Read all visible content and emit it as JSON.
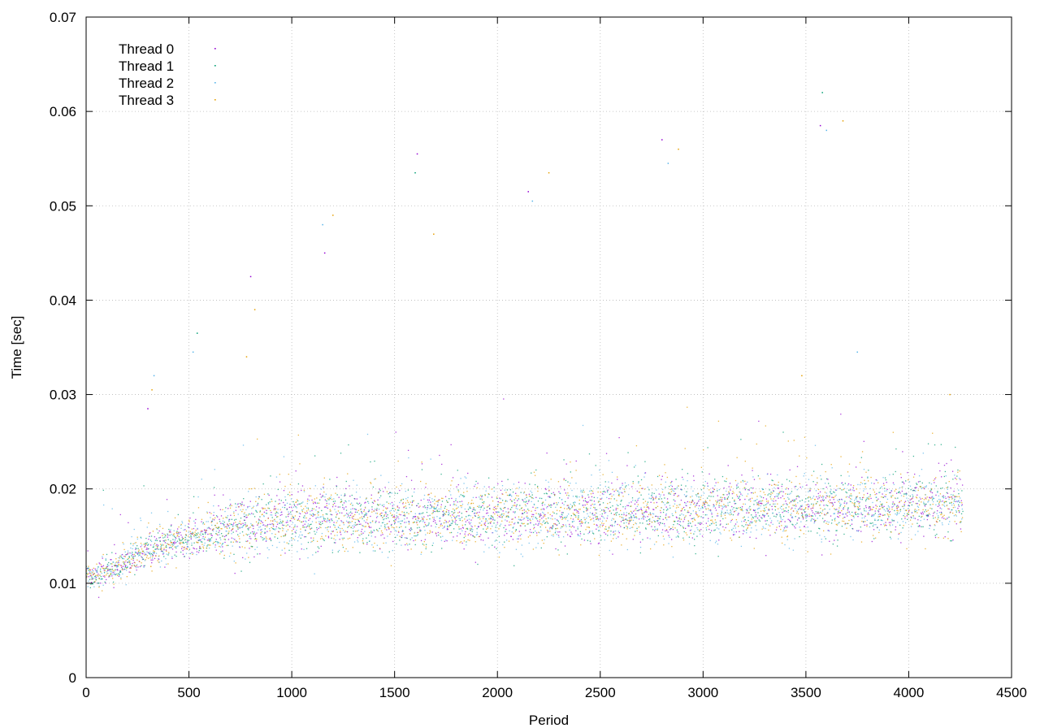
{
  "chart_data": {
    "type": "scatter",
    "title": "",
    "xlabel": "Period",
    "ylabel": "Time [sec]",
    "xlim": [
      0,
      4500
    ],
    "ylim": [
      0,
      0.07
    ],
    "xticks": [
      0,
      500,
      1000,
      1500,
      2000,
      2500,
      3000,
      3500,
      4000,
      4500
    ],
    "yticks": [
      0,
      0.01,
      0.02,
      0.03,
      0.04,
      0.05,
      0.06,
      0.07
    ],
    "grid": true,
    "legend_position": "top-left",
    "marker": "dot",
    "series": [
      {
        "name": "Thread 0",
        "color": "#9400d3"
      },
      {
        "name": "Thread 1",
        "color": "#009e73"
      },
      {
        "name": "Thread 2",
        "color": "#56b4e9"
      },
      {
        "name": "Thread 3",
        "color": "#e69f00"
      }
    ],
    "trend": {
      "description_points": [
        {
          "x": 0,
          "y": 0.0105
        },
        {
          "x": 100,
          "y": 0.0112
        },
        {
          "x": 250,
          "y": 0.013
        },
        {
          "x": 500,
          "y": 0.015
        },
        {
          "x": 750,
          "y": 0.016
        },
        {
          "x": 1000,
          "y": 0.0168
        },
        {
          "x": 1500,
          "y": 0.017
        },
        {
          "x": 2000,
          "y": 0.0172
        },
        {
          "x": 2500,
          "y": 0.0175
        },
        {
          "x": 3000,
          "y": 0.0178
        },
        {
          "x": 3500,
          "y": 0.018
        },
        {
          "x": 4000,
          "y": 0.0182
        },
        {
          "x": 4260,
          "y": 0.0183
        }
      ],
      "x_end": 4260
    },
    "outliers": [
      {
        "x": 300,
        "y": 0.0285,
        "series": 0
      },
      {
        "x": 320,
        "y": 0.0305,
        "series": 3
      },
      {
        "x": 330,
        "y": 0.032,
        "series": 2
      },
      {
        "x": 520,
        "y": 0.0345,
        "series": 2
      },
      {
        "x": 540,
        "y": 0.0365,
        "series": 1
      },
      {
        "x": 780,
        "y": 0.034,
        "series": 3
      },
      {
        "x": 800,
        "y": 0.0425,
        "series": 0
      },
      {
        "x": 820,
        "y": 0.039,
        "series": 3
      },
      {
        "x": 1150,
        "y": 0.048,
        "series": 2
      },
      {
        "x": 1160,
        "y": 0.045,
        "series": 0
      },
      {
        "x": 1200,
        "y": 0.049,
        "series": 3
      },
      {
        "x": 1600,
        "y": 0.0535,
        "series": 1
      },
      {
        "x": 1610,
        "y": 0.0555,
        "series": 0
      },
      {
        "x": 1690,
        "y": 0.047,
        "series": 3
      },
      {
        "x": 2150,
        "y": 0.0515,
        "series": 0
      },
      {
        "x": 2170,
        "y": 0.0505,
        "series": 2
      },
      {
        "x": 2250,
        "y": 0.0535,
        "series": 3
      },
      {
        "x": 2800,
        "y": 0.057,
        "series": 0
      },
      {
        "x": 2830,
        "y": 0.0545,
        "series": 2
      },
      {
        "x": 2880,
        "y": 0.056,
        "series": 3
      },
      {
        "x": 3570,
        "y": 0.0585,
        "series": 0
      },
      {
        "x": 3580,
        "y": 0.062,
        "series": 1
      },
      {
        "x": 3600,
        "y": 0.058,
        "series": 2
      },
      {
        "x": 3680,
        "y": 0.059,
        "series": 3
      },
      {
        "x": 3750,
        "y": 0.0345,
        "series": 2
      },
      {
        "x": 3480,
        "y": 0.032,
        "series": 3
      },
      {
        "x": 4200,
        "y": 0.03,
        "series": 3
      }
    ]
  }
}
